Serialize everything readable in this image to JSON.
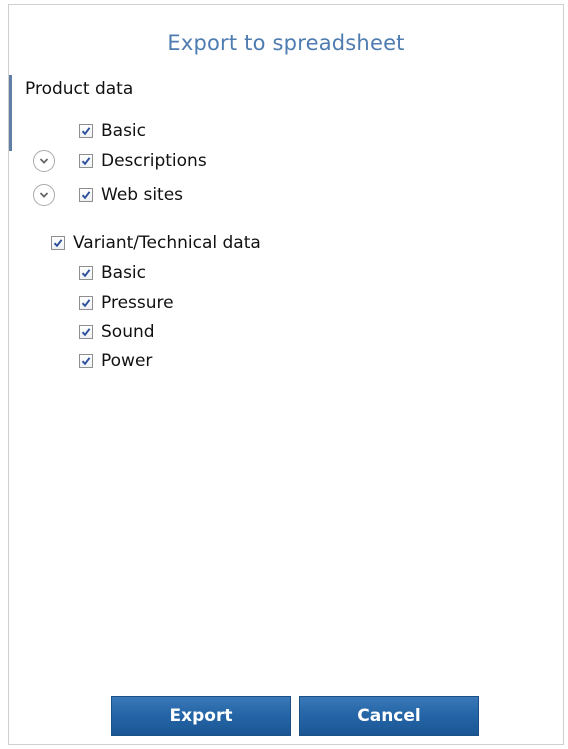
{
  "dialog": {
    "title": "Export to spreadsheet"
  },
  "product_data": {
    "label": "Product data",
    "items": [
      {
        "label": "Basic",
        "checked": true,
        "expandable": false
      },
      {
        "label": "Descriptions",
        "checked": true,
        "expandable": true
      },
      {
        "label": "Web sites",
        "checked": true,
        "expandable": true
      }
    ]
  },
  "variant_data": {
    "label": "Variant/Technical data",
    "checked": true,
    "items": [
      {
        "label": "Basic",
        "checked": true
      },
      {
        "label": "Pressure",
        "checked": true
      },
      {
        "label": "Sound",
        "checked": true
      },
      {
        "label": "Power",
        "checked": true
      }
    ]
  },
  "buttons": {
    "export_label": "Export",
    "cancel_label": "Cancel"
  },
  "colors": {
    "title": "#4e7cb0",
    "button": "#2566a8",
    "check": "#2a4f9a"
  }
}
